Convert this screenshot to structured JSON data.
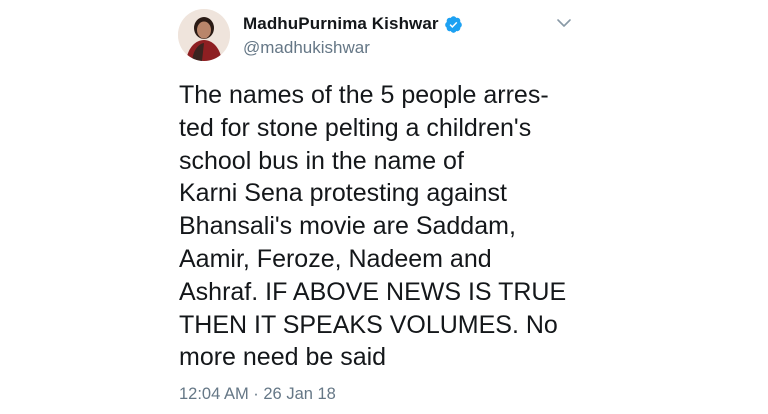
{
  "tweet": {
    "display_name": "MadhuPurnima Kishwar",
    "verified_icon": "verified-badge-icon",
    "handle": "@madhukishwar",
    "caret_icon": "chevron-down-icon",
    "text": "The names of the 5 people arres-\nted for stone pelting a children's\nschool bus in the name of\nKarni Sena protesting against\nBhansali's movie are Saddam,\nAamir, Feroze, Nadeem and\nAshraf. IF ABOVE NEWS IS TRUE\nTHEN IT SPEAKS VOLUMES. No\nmore need be said",
    "timestamp": "12:04 AM · 26 Jan 18"
  },
  "colors": {
    "text": "#14171a",
    "secondary": "#657786",
    "verified": "#1da1f2",
    "background": "#ffffff"
  }
}
